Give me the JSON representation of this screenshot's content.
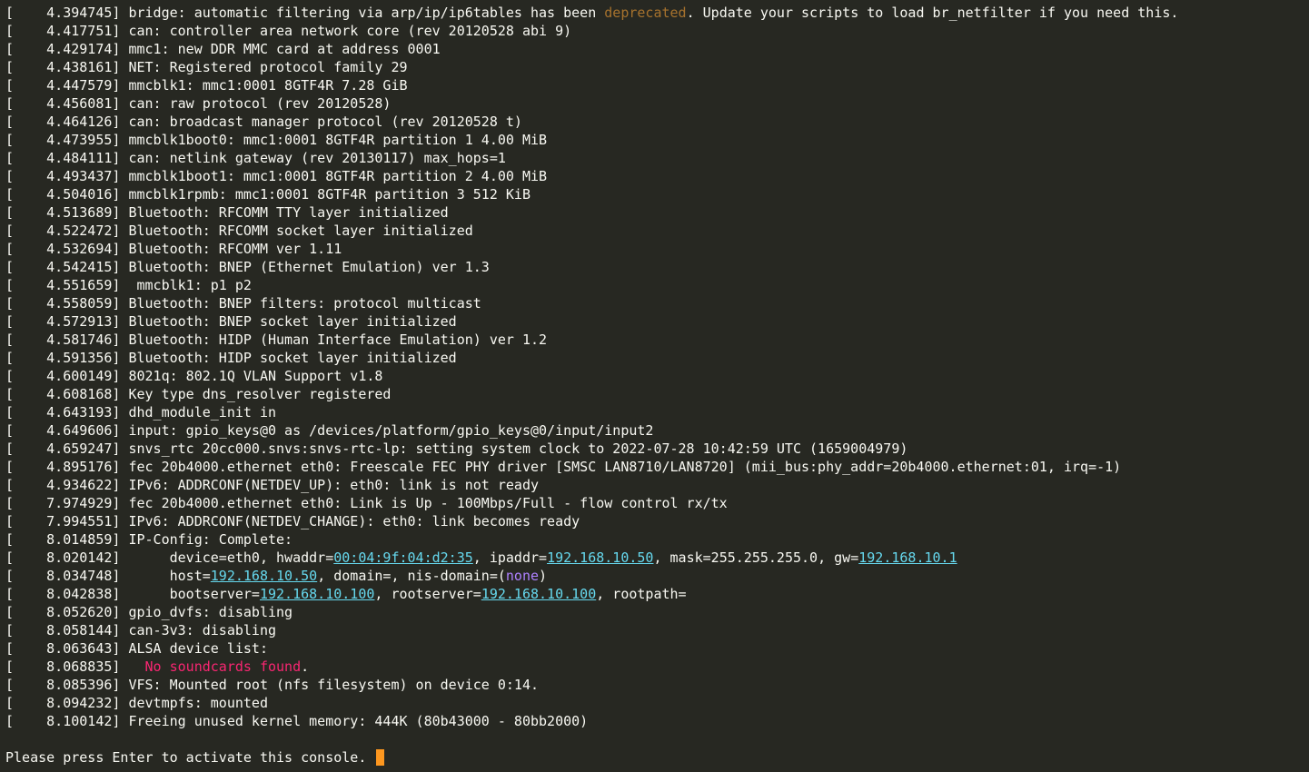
{
  "lines": [
    {
      "bracket": "[",
      "ts": "4.394745",
      "segs": [
        {
          "t": "bridge: automatic filtering via arp/ip/ip6tables has been "
        },
        {
          "t": "deprecated",
          "cls": "keyword"
        },
        {
          "t": ". Update your scripts to load br_netfilter if you need this."
        }
      ]
    },
    {
      "bracket": "[",
      "ts": "4.417751",
      "segs": [
        {
          "t": "can: controller area network core (rev 20120528 abi 9)"
        }
      ]
    },
    {
      "bracket": "[",
      "ts": "4.429174",
      "segs": [
        {
          "t": "mmc1: new DDR MMC card at address 0001"
        }
      ]
    },
    {
      "bracket": "[",
      "ts": "4.438161",
      "segs": [
        {
          "t": "NET: Registered protocol family 29"
        }
      ]
    },
    {
      "bracket": "[",
      "ts": "4.447579",
      "segs": [
        {
          "t": "mmcblk1: mmc1:0001 8GTF4R 7.28 GiB"
        }
      ]
    },
    {
      "bracket": "[",
      "ts": "4.456081",
      "segs": [
        {
          "t": "can: raw protocol (rev 20120528)"
        }
      ]
    },
    {
      "bracket": "[",
      "ts": "4.464126",
      "segs": [
        {
          "t": "can: broadcast manager protocol (rev 20120528 t)"
        }
      ]
    },
    {
      "bracket": "[",
      "ts": "4.473955",
      "segs": [
        {
          "t": "mmcblk1boot0: mmc1:0001 8GTF4R partition 1 4.00 MiB"
        }
      ]
    },
    {
      "bracket": "[",
      "ts": "4.484111",
      "segs": [
        {
          "t": "can: netlink gateway (rev 20130117) max_hops=1"
        }
      ]
    },
    {
      "bracket": "[",
      "ts": "4.493437",
      "segs": [
        {
          "t": "mmcblk1boot1: mmc1:0001 8GTF4R partition 2 4.00 MiB"
        }
      ]
    },
    {
      "bracket": "[",
      "ts": "4.504016",
      "segs": [
        {
          "t": "mmcblk1rpmb: mmc1:0001 8GTF4R partition 3 512 KiB"
        }
      ]
    },
    {
      "bracket": "[",
      "ts": "4.513689",
      "segs": [
        {
          "t": "Bluetooth: RFCOMM TTY layer initialized"
        }
      ]
    },
    {
      "bracket": "[",
      "ts": "4.522472",
      "segs": [
        {
          "t": "Bluetooth: RFCOMM socket layer initialized"
        }
      ]
    },
    {
      "bracket": "[",
      "ts": "4.532694",
      "segs": [
        {
          "t": "Bluetooth: RFCOMM ver 1.11"
        }
      ]
    },
    {
      "bracket": "[",
      "ts": "4.542415",
      "segs": [
        {
          "t": "Bluetooth: BNEP (Ethernet Emulation) ver 1.3"
        }
      ]
    },
    {
      "bracket": "[",
      "ts": "4.551659",
      "segs": [
        {
          "t": " mmcblk1: p1 p2"
        }
      ]
    },
    {
      "bracket": "[",
      "ts": "4.558059",
      "segs": [
        {
          "t": "Bluetooth: BNEP filters: protocol multicast"
        }
      ]
    },
    {
      "bracket": "[",
      "ts": "4.572913",
      "segs": [
        {
          "t": "Bluetooth: BNEP socket layer initialized"
        }
      ]
    },
    {
      "bracket": "[",
      "ts": "4.581746",
      "segs": [
        {
          "t": "Bluetooth: HIDP (Human Interface Emulation) ver 1.2"
        }
      ]
    },
    {
      "bracket": "[",
      "ts": "4.591356",
      "segs": [
        {
          "t": "Bluetooth: HIDP socket layer initialized"
        }
      ]
    },
    {
      "bracket": "[",
      "ts": "4.600149",
      "segs": [
        {
          "t": "8021q: 802.1Q VLAN Support v1.8"
        }
      ]
    },
    {
      "bracket": "[",
      "ts": "4.608168",
      "segs": [
        {
          "t": "Key type dns_resolver registered"
        }
      ]
    },
    {
      "bracket": "[",
      "ts": "4.643193",
      "segs": [
        {
          "t": "dhd_module_init in"
        }
      ]
    },
    {
      "bracket": "[",
      "ts": "4.649606",
      "segs": [
        {
          "t": "input: gpio_keys@0 as /devices/platform/gpio_keys@0/input/input2"
        }
      ]
    },
    {
      "bracket": "[",
      "ts": "4.659247",
      "segs": [
        {
          "t": "snvs_rtc 20cc000.snvs:snvs-rtc-lp: setting system clock to 2022-07-28 10:42:59 UTC (1659004979)"
        }
      ]
    },
    {
      "bracket": "[",
      "ts": "4.895176",
      "segs": [
        {
          "t": "fec 20b4000.ethernet eth0: Freescale FEC PHY driver [SMSC LAN8710/LAN8720] (mii_bus:phy_addr=20b4000.ethernet:01, irq=-1)"
        }
      ]
    },
    {
      "bracket": "[",
      "ts": "4.934622",
      "segs": [
        {
          "t": "IPv6: ADDRCONF(NETDEV_UP): eth0: link is not ready"
        }
      ]
    },
    {
      "bracket": "[",
      "ts": "7.974929",
      "segs": [
        {
          "t": "fec 20b4000.ethernet eth0: Link is Up - 100Mbps/Full - flow control rx/tx"
        }
      ]
    },
    {
      "bracket": "[",
      "ts": "7.994551",
      "segs": [
        {
          "t": "IPv6: ADDRCONF(NETDEV_CHANGE): eth0: link becomes ready"
        }
      ]
    },
    {
      "bracket": "[",
      "ts": "8.014859",
      "segs": [
        {
          "t": "IP-Config: Complete:"
        }
      ]
    },
    {
      "bracket": "[",
      "ts": "8.020142",
      "segs": [
        {
          "t": "     device=eth0, hwaddr="
        },
        {
          "t": "00:04:9f:04:d2:35",
          "cls": "link"
        },
        {
          "t": ", ipaddr="
        },
        {
          "t": "192.168.10.50",
          "cls": "link"
        },
        {
          "t": ", mask=255.255.255.0, gw="
        },
        {
          "t": "192.168.10.1",
          "cls": "link"
        }
      ]
    },
    {
      "bracket": "[",
      "ts": "8.034748",
      "segs": [
        {
          "t": "     host="
        },
        {
          "t": "192.168.10.50",
          "cls": "link"
        },
        {
          "t": ", domain=, nis-domain=("
        },
        {
          "t": "none",
          "cls": "value"
        },
        {
          "t": ")"
        }
      ]
    },
    {
      "bracket": "[",
      "ts": "8.042838",
      "segs": [
        {
          "t": "     bootserver="
        },
        {
          "t": "192.168.10.100",
          "cls": "link"
        },
        {
          "t": ", rootserver="
        },
        {
          "t": "192.168.10.100",
          "cls": "link"
        },
        {
          "t": ", rootpath="
        }
      ]
    },
    {
      "bracket": "[",
      "ts": "8.052620",
      "segs": [
        {
          "t": "gpio_dvfs: disabling"
        }
      ]
    },
    {
      "bracket": "[",
      "ts": "8.058144",
      "segs": [
        {
          "t": "can-3v3: disabling"
        }
      ]
    },
    {
      "bracket": "[",
      "ts": "8.063643",
      "segs": [
        {
          "t": "ALSA device list:"
        }
      ]
    },
    {
      "bracket": "[",
      "ts": "8.068835",
      "segs": [
        {
          "t": "  "
        },
        {
          "t": "No soundcards found",
          "cls": "warn"
        },
        {
          "t": "."
        }
      ]
    },
    {
      "bracket": "[",
      "ts": "8.085396",
      "segs": [
        {
          "t": "VFS: Mounted root (nfs filesystem) on device 0:14."
        }
      ]
    },
    {
      "bracket": "[",
      "ts": "8.094232",
      "segs": [
        {
          "t": "devtmpfs: mounted"
        }
      ]
    },
    {
      "bracket": "[",
      "ts": "8.100142",
      "segs": [
        {
          "t": "Freeing unused kernel memory: 444K (80b43000 - 80bb2000)"
        }
      ]
    }
  ],
  "blank_line": "",
  "prompt": "Please press Enter to activate this console. "
}
